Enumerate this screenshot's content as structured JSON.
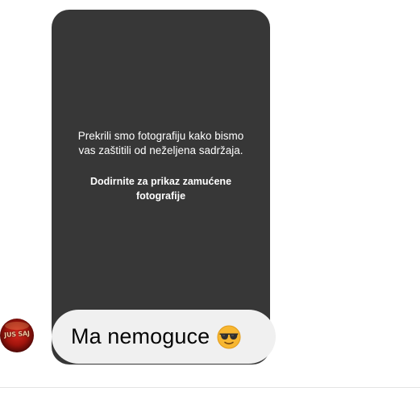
{
  "photo_card": {
    "notice": "Prekrili smo fotografiju kako bismo vas zaštitili od neželjena sadržaja.",
    "action": "Dodirnite za prikaz zamućene fotografije",
    "background_color": "#373737"
  },
  "message": {
    "text": "Ma nemoguce",
    "emoji_icon": "smiling-face-with-sunglasses-icon",
    "bubble_color": "#f0f0f0"
  },
  "sender": {
    "avatar_text": "JUS SAJ"
  }
}
